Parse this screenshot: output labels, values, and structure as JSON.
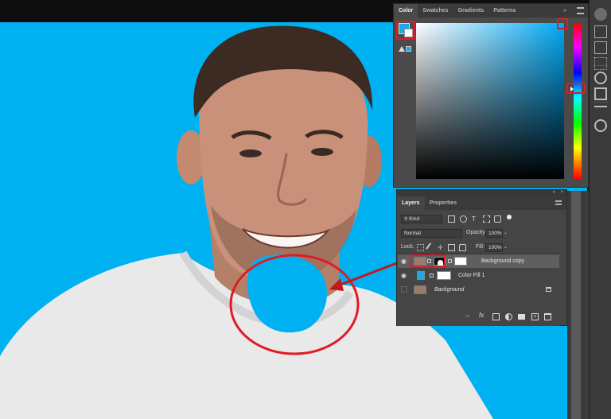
{
  "color_panel": {
    "tabs": [
      {
        "label": "Color",
        "active": true
      },
      {
        "label": "Swatches",
        "active": false
      },
      {
        "label": "Gradients",
        "active": false
      },
      {
        "label": "Patterns",
        "active": false
      }
    ],
    "foreground_color": "#1aa9e6",
    "field_hue": "#00aaf6"
  },
  "layers_panel": {
    "tabs": [
      {
        "label": "Layers",
        "active": true
      },
      {
        "label": "Properties",
        "active": false
      }
    ],
    "filter_kind": "Kind",
    "blend_mode": "Normal",
    "opacity_label": "Opacity:",
    "opacity_value": "100%",
    "lock_label": "Lock:",
    "fill_label": "Fill:",
    "fill_value": "100%",
    "layers": [
      {
        "name": "Background copy",
        "visible": true,
        "selected": true
      },
      {
        "name": "Color Fill 1",
        "visible": true,
        "selected": false
      },
      {
        "name": "Background",
        "visible": false,
        "selected": false,
        "locked": true
      }
    ]
  },
  "colors": {
    "canvas_bg": "#00b1f2",
    "highlight": "#e01b24",
    "panel_bg": "#4a4a4a"
  }
}
